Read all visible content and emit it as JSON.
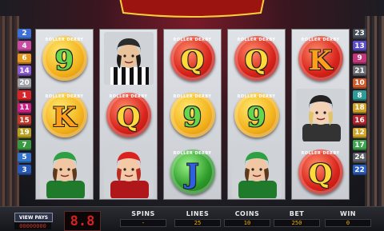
{
  "paylines_left": [
    {
      "n": "2",
      "color": "#3d6fd4"
    },
    {
      "n": "4",
      "color": "#c74aa3"
    },
    {
      "n": "6",
      "color": "#e39a23"
    },
    {
      "n": "14",
      "color": "#8c5bd1"
    },
    {
      "n": "20",
      "color": "#9fa2a8"
    },
    {
      "n": "1",
      "color": "#d8252b"
    },
    {
      "n": "11",
      "color": "#cf1f86"
    },
    {
      "n": "15",
      "color": "#c53b2b"
    },
    {
      "n": "19",
      "color": "#b8a11c"
    },
    {
      "n": "7",
      "color": "#3a9a42"
    },
    {
      "n": "5",
      "color": "#3273c9"
    },
    {
      "n": "3",
      "color": "#2a58b8"
    }
  ],
  "paylines_right": [
    {
      "n": "23",
      "color": "#434c57"
    },
    {
      "n": "13",
      "color": "#5a4fc7"
    },
    {
      "n": "9",
      "color": "#c2387a"
    },
    {
      "n": "21",
      "color": "#6b6e74"
    },
    {
      "n": "10",
      "color": "#d05b2a"
    },
    {
      "n": "8",
      "color": "#2f9c9a"
    },
    {
      "n": "18",
      "color": "#d0a227"
    },
    {
      "n": "16",
      "color": "#b0242b"
    },
    {
      "n": "12",
      "color": "#cfa428"
    },
    {
      "n": "17",
      "color": "#3fa64f"
    },
    {
      "n": "24",
      "color": "#5a5d63"
    },
    {
      "n": "22",
      "color": "#2a5ec0"
    }
  ],
  "reels": [
    [
      {
        "type": "coin",
        "glyph": "9",
        "coin": "c-green",
        "color": "g-green",
        "ring": "ROLLER DERBY"
      },
      {
        "type": "coin",
        "glyph": "K",
        "coin": "c-green",
        "color": "g-orange",
        "ring": "ROLLER DERBY"
      },
      {
        "type": "char",
        "name": "green-skater"
      }
    ],
    [
      {
        "type": "char",
        "name": "referee"
      },
      {
        "type": "coin",
        "glyph": "Q",
        "coin": "c-red",
        "color": "g-yellow",
        "ring": "ROLLER DERBY"
      },
      {
        "type": "char",
        "name": "red-skater"
      }
    ],
    [
      {
        "type": "coin",
        "glyph": "Q",
        "coin": "c-red",
        "color": "g-yellow",
        "ring": "ROLLER DERBY"
      },
      {
        "type": "coin",
        "glyph": "9",
        "coin": "c-green",
        "color": "g-green",
        "ring": "ROLLER DERBY"
      },
      {
        "type": "coin",
        "glyph": "J",
        "coin": "c-blue",
        "color": "g-blue",
        "ring": "ROLLER DERBY"
      }
    ],
    [
      {
        "type": "coin",
        "glyph": "Q",
        "coin": "c-red",
        "color": "g-yellow",
        "ring": "ROLLER DERBY"
      },
      {
        "type": "coin",
        "glyph": "9",
        "coin": "c-green",
        "color": "g-green",
        "ring": "ROLLER DERBY"
      },
      {
        "type": "char",
        "name": "green-skater"
      }
    ],
    [
      {
        "type": "coin",
        "glyph": "K",
        "coin": "c-red",
        "color": "g-orange",
        "ring": "ROLLER DERBY"
      },
      {
        "type": "char",
        "name": "blonde-skater"
      },
      {
        "type": "coin",
        "glyph": "Q",
        "coin": "c-red",
        "color": "g-yellow",
        "ring": "ROLLER DERBY"
      }
    ]
  ],
  "bottom": {
    "view_pays": "VIEW PAYS",
    "credits_digits": "00000000",
    "led": "8.8",
    "spins_label": "SPINS",
    "spins_value": "-",
    "lines_label": "LINES",
    "lines_value": "25",
    "coins_label": "COINS",
    "coins_value": "10",
    "bet_label": "BET",
    "bet_value": "250",
    "win_label": "WIN",
    "win_value": "0"
  }
}
